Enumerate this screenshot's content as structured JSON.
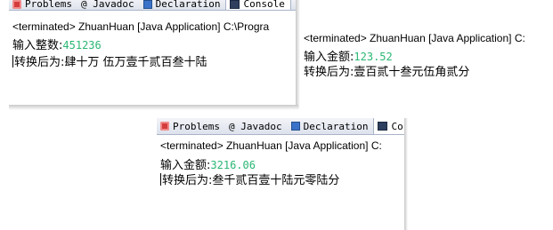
{
  "panel1": {
    "tabs": [
      "Problems",
      "@ Javadoc",
      "Declaration",
      "Console"
    ],
    "title": "<terminated> ZhuanHuan [Java Application] C:\\Progra",
    "lines": [
      {
        "label": "输入整数:",
        "value": "451236"
      },
      {
        "label": "转换后为:",
        "value": "肆十万 伍万壹千贰百叁十陆"
      }
    ]
  },
  "panel2": {
    "title": "<terminated> ZhuanHuan [Java Application] C:",
    "lines": [
      {
        "label": "输入金额:",
        "value": "123.52"
      },
      {
        "label": "转换后为:",
        "value": "壹百贰十叁元伍角贰分"
      }
    ]
  },
  "panel3": {
    "tabs": [
      "Problems",
      "@ Javadoc",
      "Declaration",
      "Co"
    ],
    "title": "<terminated> ZhuanHuan [Java Application] C:",
    "lines": [
      {
        "label": "输入金额:",
        "value": "3216.06"
      },
      {
        "label": "转换后为:",
        "value": "叁千贰百壹十陆元零陆分"
      }
    ]
  },
  "colors": {
    "value_green": "#2bb673",
    "tab_border": "#a9b4c8"
  }
}
